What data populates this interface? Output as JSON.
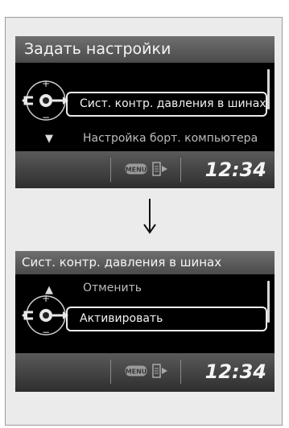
{
  "screen1": {
    "title": "Задать настройки",
    "selected_item": "Сист. контр. давления в шинах",
    "next_item": "Настройка борт. компьютера",
    "next_item_arrow": "▼",
    "status": {
      "menu_label": "MENU",
      "clock": "12:34"
    }
  },
  "screen2": {
    "title": "Сист. контр. давления в шинах",
    "prev_item": "Отменить",
    "prev_item_arrow": "▲",
    "selected_item": "Активировать",
    "status": {
      "menu_label": "MENU",
      "clock": "12:34"
    }
  },
  "transition_arrow": "down-arrow-icon",
  "colors": {
    "screen_bg": "#000000",
    "title_bar": "#5c5c5c",
    "frame_bg": "#ebebeb",
    "text": "#f2f2f2"
  }
}
